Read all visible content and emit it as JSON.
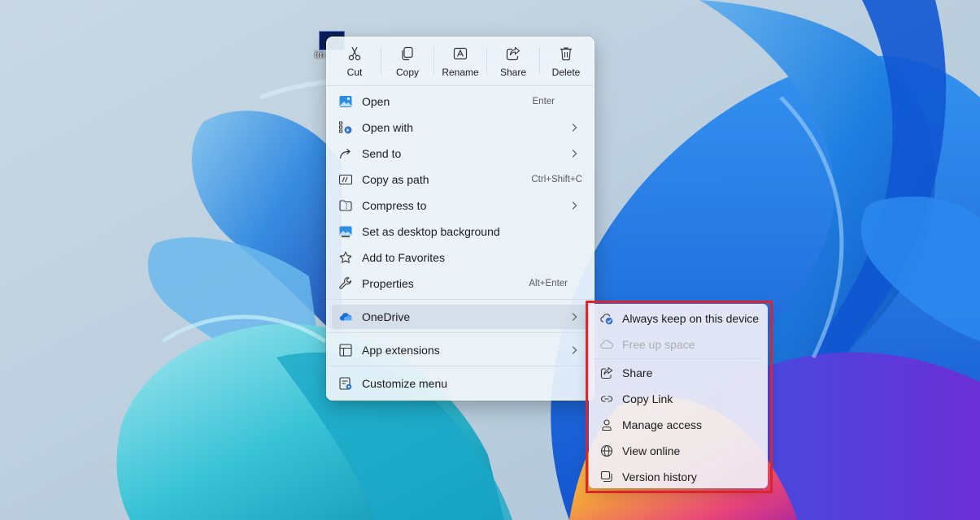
{
  "desktop": {
    "icon_label": "im"
  },
  "toolbar": {
    "cut": "Cut",
    "copy": "Copy",
    "rename": "Rename",
    "share": "Share",
    "delete": "Delete"
  },
  "menu": {
    "open": {
      "label": "Open",
      "shortcut": "Enter"
    },
    "open_with": {
      "label": "Open with"
    },
    "send_to": {
      "label": "Send to"
    },
    "copy_as_path": {
      "label": "Copy as path",
      "shortcut": "Ctrl+Shift+C"
    },
    "compress_to": {
      "label": "Compress to"
    },
    "set_background": {
      "label": "Set as desktop background"
    },
    "add_favorites": {
      "label": "Add to Favorites"
    },
    "properties": {
      "label": "Properties",
      "shortcut": "Alt+Enter"
    },
    "onedrive": {
      "label": "OneDrive"
    },
    "app_extensions": {
      "label": "App extensions"
    },
    "customize_menu": {
      "label": "Customize menu"
    }
  },
  "onedrive_submenu": {
    "always_keep": "Always keep on this device",
    "free_up_space": "Free up space",
    "share": "Share",
    "copy_link": "Copy Link",
    "manage_access": "Manage access",
    "view_online": "View online",
    "version_history": "Version history"
  },
  "colors": {
    "highlight_border": "#d9252b",
    "onedrive_blue": "#1d6fd8",
    "accent": "#0f6cbd"
  }
}
